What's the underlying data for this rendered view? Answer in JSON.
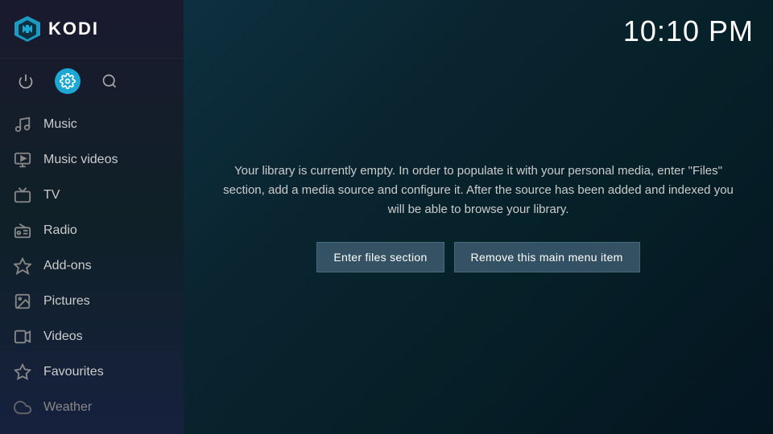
{
  "app": {
    "name": "KODI",
    "time": "10:10 PM"
  },
  "sidebar": {
    "menu_items": [
      {
        "id": "music",
        "label": "Music",
        "icon": "music"
      },
      {
        "id": "music-videos",
        "label": "Music videos",
        "icon": "music-video"
      },
      {
        "id": "tv",
        "label": "TV",
        "icon": "tv"
      },
      {
        "id": "radio",
        "label": "Radio",
        "icon": "radio"
      },
      {
        "id": "add-ons",
        "label": "Add-ons",
        "icon": "addons"
      },
      {
        "id": "pictures",
        "label": "Pictures",
        "icon": "pictures"
      },
      {
        "id": "videos",
        "label": "Videos",
        "icon": "videos"
      },
      {
        "id": "favourites",
        "label": "Favourites",
        "icon": "star"
      },
      {
        "id": "weather",
        "label": "Weather",
        "icon": "weather"
      }
    ]
  },
  "main": {
    "info_text": "Your library is currently empty. In order to populate it with your personal media, enter \"Files\" section, add a media source and configure it. After the source has been added and indexed you will be able to browse your library.",
    "buttons": {
      "enter_files": "Enter files section",
      "remove_menu": "Remove this main menu item"
    }
  }
}
